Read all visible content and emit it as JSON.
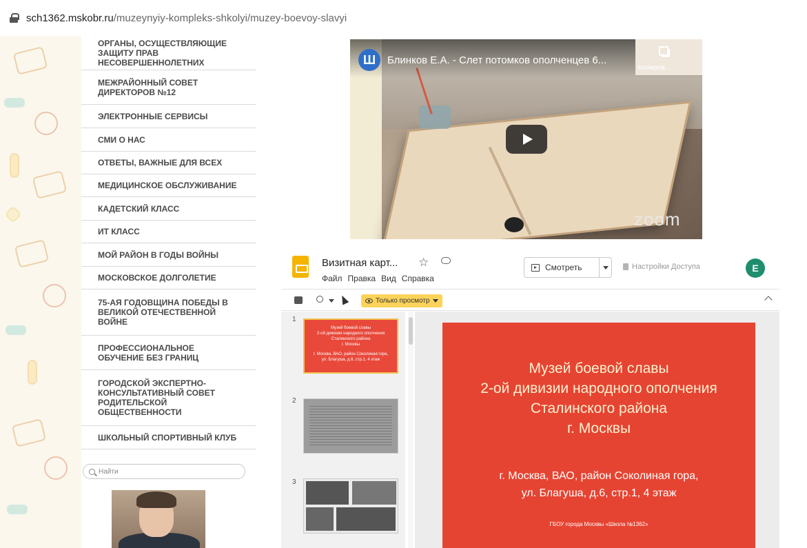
{
  "browser": {
    "url_host": "sch1362.mskobr.ru",
    "url_path": "/muzeynyiy-kompleks-shkolyi/muzey-boevoy-slavyi"
  },
  "sidebar": {
    "items": [
      "ОРГАНЫ, ОСУЩЕСТВЛЯЮЩИЕ ЗАЩИТУ ПРАВ НЕСОВЕРШЕННОЛЕТНИХ",
      "МЕЖРАЙОННЫЙ СОВЕТ ДИРЕКТОРОВ №12",
      "ЭЛЕКТРОННЫЕ СЕРВИСЫ",
      "СМИ О НАС",
      "ОТВЕТЫ, ВАЖНЫЕ ДЛЯ ВСЕХ",
      "МЕДИЦИНСКОЕ ОБСЛУЖИВАНИЕ",
      "КАДЕТСКИЙ КЛАСС",
      "ИТ КЛАСС",
      "МОЙ РАЙОН В ГОДЫ ВОЙНЫ",
      "МОСКОВСКОЕ ДОЛГОЛЕТИЕ",
      "75-АЯ ГОДОВЩИНА ПОБЕДЫ В ВЕЛИКОЙ ОТЕЧЕСТВЕННОЙ ВОЙНЕ",
      "ПРОФЕССИОНАЛЬНОЕ ОБУЧЕНИЕ БЕЗ ГРАНИЦ",
      "ГОРОДСКОЙ ЭКСПЕРТНО-КОНСУЛЬТАТИВНЫЙ СОВЕТ РОДИТЕЛЬСКОЙ ОБЩЕСТВЕННОСТИ",
      "ШКОЛЬНЫЙ СПОРТИВНЫЙ КЛУБ"
    ],
    "search_placeholder": "Найти"
  },
  "video": {
    "channel_letter": "Ш",
    "title": "Блинков Е.А. - Слет потомков ополченцев 6...",
    "copy_label": "Копиров...",
    "watermark": "zoom"
  },
  "slides_app": {
    "doc_title": "Визитная карт...",
    "menu": [
      "Файл",
      "Правка",
      "Вид",
      "Справка"
    ],
    "view_button": "Смотреть",
    "access_button": "Настройки Доступа",
    "user_initial": "E",
    "view_only_label": "Только просмотр",
    "thumb_numbers": [
      "1",
      "2",
      "3"
    ],
    "thumb1_lines": [
      "Музей боевой славы",
      "2-ой дивизии народного ополчения",
      "Сталинского района",
      "г. Москвы",
      "г. Москва, ВАО, район Соколиная гора,",
      "ул. Благуша, д.6, стр.1, 4 этаж"
    ],
    "slide": {
      "title_lines": [
        "Музей боевой славы",
        "2-ой дивизии народного ополчения",
        "Сталинского района",
        "г. Москвы"
      ],
      "address_lines": [
        "г. Москва, ВАО, район Соколиная гора,",
        "ул. Благуша, д.6, стр.1, 4 этаж"
      ],
      "school": "ГБОУ города Москвы «Школа №1362»"
    }
  }
}
